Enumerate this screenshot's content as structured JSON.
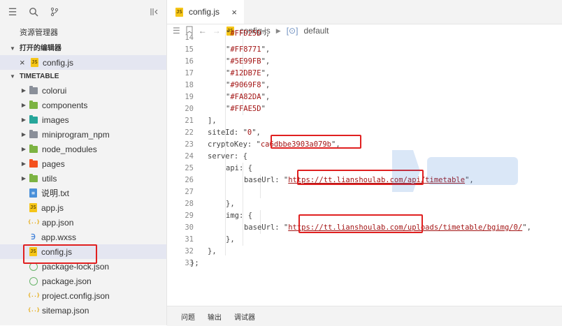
{
  "sidebar": {
    "title": "资源管理器",
    "open_editors_label": "打开的编辑器",
    "open_editor_close": "×",
    "open_editor_file": "config.js",
    "project_label": "TIMETABLE",
    "tree": [
      {
        "label": "colorui",
        "type": "folder",
        "color": "#8a8f99"
      },
      {
        "label": "components",
        "type": "folder",
        "color": "#7cb342"
      },
      {
        "label": "images",
        "type": "folder",
        "color": "#26a69a"
      },
      {
        "label": "miniprogram_npm",
        "type": "folder",
        "color": "#8a8f99"
      },
      {
        "label": "node_modules",
        "type": "folder",
        "color": "#7cb342"
      },
      {
        "label": "pages",
        "type": "folder",
        "color": "#f4511e"
      },
      {
        "label": "utils",
        "type": "folder",
        "color": "#7cb342"
      },
      {
        "label": "说明.txt",
        "type": "txt"
      },
      {
        "label": "app.js",
        "type": "js"
      },
      {
        "label": "app.json",
        "type": "json"
      },
      {
        "label": "app.wxss",
        "type": "wxss"
      },
      {
        "label": "config.js",
        "type": "js",
        "selected": true
      },
      {
        "label": "package-lock.json",
        "type": "pkg"
      },
      {
        "label": "package.json",
        "type": "pkg"
      },
      {
        "label": "project.config.json",
        "type": "json"
      },
      {
        "label": "sitemap.json",
        "type": "json"
      }
    ]
  },
  "editor": {
    "tab_label": "config.js",
    "tab_close": "×",
    "breadcrumb_file": "config.js",
    "breadcrumb_symbol": "default",
    "lines": [
      {
        "n": "14",
        "text": "\"#FFD25D\","
      },
      {
        "n": "15",
        "text": "\"#FF8771\","
      },
      {
        "n": "16",
        "text": "\"#5E99FB\","
      },
      {
        "n": "17",
        "text": "\"#12DB7E\","
      },
      {
        "n": "18",
        "text": "\"#9069F8\","
      },
      {
        "n": "19",
        "text": "\"#FA82DA\","
      },
      {
        "n": "20",
        "text": "\"#FFAE5D\""
      },
      {
        "n": "21",
        "text": "],"
      },
      {
        "n": "22",
        "text": "siteId: \"0\","
      },
      {
        "n": "23",
        "text": "cryptoKey: \"ca6dbbe3903a079b\","
      },
      {
        "n": "24",
        "text": "server: {"
      },
      {
        "n": "25",
        "text": "api: {"
      },
      {
        "n": "26",
        "text": "baseUrl: \"https://tt.lianshoulab.com/api/timetable\","
      },
      {
        "n": "27",
        "text": ""
      },
      {
        "n": "28",
        "text": "},"
      },
      {
        "n": "29",
        "text": "img: {"
      },
      {
        "n": "30",
        "text": "baseUrl: \"https://tt.lianshoulab.com/uploads/timetable/bgimg/0/\","
      },
      {
        "n": "31",
        "text": "},"
      },
      {
        "n": "32",
        "text": "},"
      },
      {
        "n": "33",
        "text": "};"
      }
    ]
  },
  "bottom_panel": {
    "tabs": [
      "问题",
      "输出",
      "调试器"
    ]
  },
  "colors": {
    "highlight_box": "#e02020",
    "selection": "#e4e6f1"
  }
}
